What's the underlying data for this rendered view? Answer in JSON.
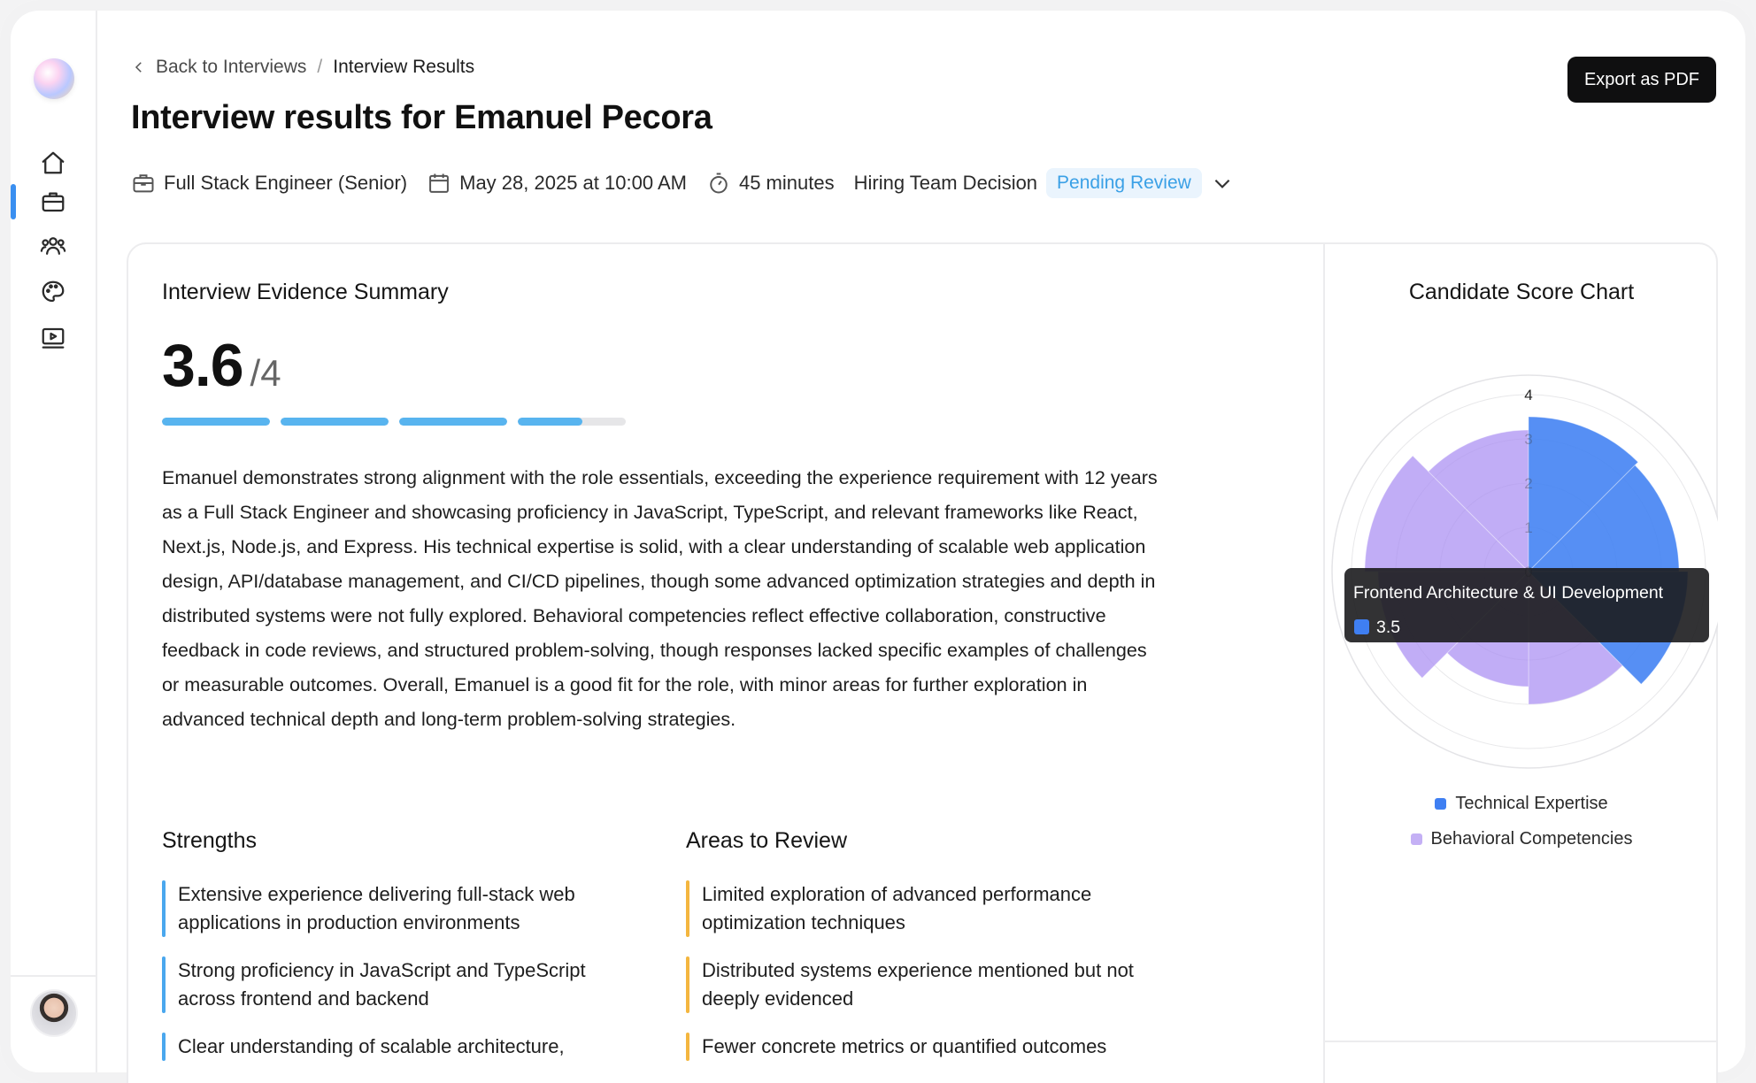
{
  "breadcrumb": {
    "back": "Back to Interviews",
    "separator": "/",
    "current": "Interview Results"
  },
  "page": {
    "title": "Interview results for Emanuel Pecora",
    "export_label": "Export as PDF"
  },
  "meta": {
    "role": "Full Stack Engineer (Senior)",
    "date": "May 28, 2025 at 10:00 AM",
    "duration": "45 minutes",
    "decision_label": "Hiring Team Decision",
    "decision_status": "Pending Review"
  },
  "summary": {
    "heading": "Interview Evidence Summary",
    "score": "3.6",
    "score_max": "/4",
    "progress_segments": [
      1,
      1,
      1,
      0.6
    ],
    "text": "Emanuel demonstrates strong alignment with the role essentials, exceeding the experience requirement with 12 years as a Full Stack Engineer and showcasing proficiency in JavaScript, TypeScript, and relevant frameworks like React, Next.js, Node.js, and Express. His technical expertise is solid, with a clear understanding of scalable web application design, API/database management, and CI/CD pipelines, though some advanced optimization strategies and depth in distributed systems were not fully explored. Behavioral competencies reflect effective collaboration, constructive feedback in code reviews, and structured problem-solving, though responses lacked specific examples of challenges or measurable outcomes. Overall, Emanuel is a good fit for the role, with minor areas for further exploration in advanced technical depth and long-term problem-solving strategies."
  },
  "strengths": {
    "heading": "Strengths",
    "items": [
      "Extensive experience delivering full-stack web applications in production environments",
      "Strong proficiency in JavaScript and TypeScript across frontend and backend",
      "Clear understanding of scalable architecture,"
    ]
  },
  "review": {
    "heading": "Areas to Review",
    "items": [
      "Limited exploration of advanced performance optimization techniques",
      "Distributed systems experience mentioned but not deeply evidenced",
      "Fewer concrete metrics or quantified outcomes"
    ]
  },
  "tooltip": {
    "label": "Frontend Architecture & UI Development",
    "value": "3.5"
  },
  "chart_data": {
    "type": "polar-area",
    "title": "Candidate Score Chart",
    "r_max": 4,
    "r_ticks": [
      "0",
      "1",
      "2",
      "3",
      "4"
    ],
    "series": [
      {
        "name": "Technical Expertise",
        "color": "#3f7ff2",
        "values": [
          3.5,
          3.4,
          3.6,
          null,
          null,
          null,
          null,
          null
        ]
      },
      {
        "name": "Behavioral Competencies",
        "color": "#a98df2",
        "values": [
          null,
          null,
          null,
          3.0,
          2.6,
          3.4,
          3.7,
          3.2
        ]
      }
    ]
  },
  "colors": {
    "accent": "#58b4ef",
    "technical": "#3f7ff2",
    "behavioral": "#a98df2",
    "warning": "#f4b63f"
  }
}
